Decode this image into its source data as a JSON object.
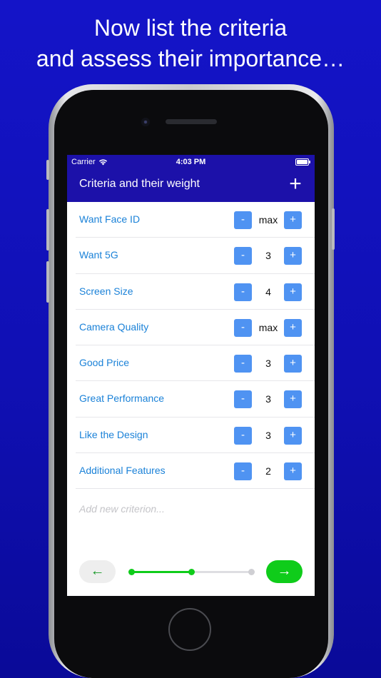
{
  "headline": {
    "line1": "Now list the criteria",
    "line2": "and assess their importance…"
  },
  "status_bar": {
    "carrier": "Carrier",
    "time": "4:03 PM",
    "icons": [
      "wifi-icon",
      "battery-icon"
    ]
  },
  "nav": {
    "title": "Criteria and their weight",
    "add_label": "+"
  },
  "criteria": [
    {
      "name": "Want Face ID",
      "weight": "max"
    },
    {
      "name": "Want 5G",
      "weight": "3"
    },
    {
      "name": "Screen Size",
      "weight": "4"
    },
    {
      "name": "Camera Quality",
      "weight": "max"
    },
    {
      "name": "Good Price",
      "weight": "3"
    },
    {
      "name": "Great Performance",
      "weight": "3"
    },
    {
      "name": "Like the Design",
      "weight": "3"
    },
    {
      "name": "Additional Features",
      "weight": "2"
    }
  ],
  "stepper": {
    "minus": "-",
    "plus": "+"
  },
  "new_criterion_placeholder": "Add new criterion...",
  "footer": {
    "back_icon": "arrow-left-icon",
    "next_icon": "arrow-right-icon",
    "back_label": "←",
    "next_label": "→",
    "progress": 0.5,
    "steps": 3,
    "current_step": 2
  },
  "colors": {
    "background": "#1414c8",
    "navbar": "#1c11a9",
    "label": "#1b82d8",
    "stepper": "#4f93f2",
    "progress": "#0fcc1a"
  }
}
